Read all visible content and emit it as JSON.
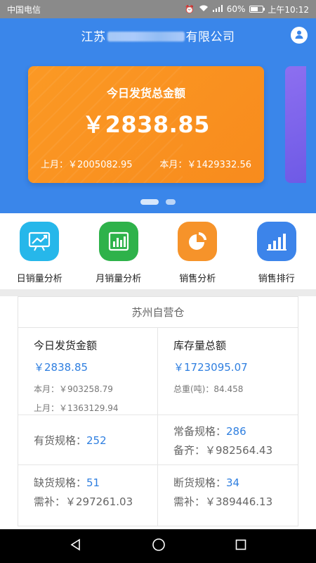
{
  "status_bar": {
    "carrier": "中国电信",
    "signal": "⁴ᴳ",
    "battery": "60%",
    "battery_level": 0.6,
    "time": "上午10:12"
  },
  "header": {
    "title_prefix": "江苏",
    "title_suffix": "有限公司"
  },
  "card": {
    "title": "今日发货总金额",
    "amount": "￥2838.85",
    "last_month": "上月：￥2005082.95",
    "this_month": "本月：￥1429332.56"
  },
  "menu": {
    "items": [
      {
        "label": "日销量分析",
        "icon": "trend-chart-icon",
        "color": "#26b7ea"
      },
      {
        "label": "月销量分析",
        "icon": "bar-chart-icon",
        "color": "#2eb24a"
      },
      {
        "label": "销售分析",
        "icon": "pie-chart-icon",
        "color": "#f6932a"
      },
      {
        "label": "销售排行",
        "icon": "ranking-bars-icon",
        "color": "#3c84ea"
      }
    ]
  },
  "warehouse": {
    "name": "苏州自营仓",
    "today_label": "今日发货金额",
    "today_amount": "￥2838.85",
    "this_month": "本月：￥903258.79",
    "last_month": "上月：￥1363129.94",
    "stock_label": "库存量总额",
    "stock_amount": "￥1723095.07",
    "total_weight": "总重(吨)：84.458",
    "in_stock_label": "有货规格：",
    "in_stock_value": "252",
    "standard_label": "常备规格：",
    "standard_value": "286",
    "standard_complete": "备齐：￥982564.43",
    "shortage_label": "缺货规格：",
    "shortage_value": "51",
    "shortage_need": "需补：￥297261.03",
    "outofstock_label": "断货规格：",
    "outofstock_value": "34",
    "outofstock_need": "需补：￥389446.13"
  },
  "colors": {
    "brand_blue": "#3a86ea",
    "card_orange": "#fb9924",
    "value_blue": "#2f7fe0"
  }
}
